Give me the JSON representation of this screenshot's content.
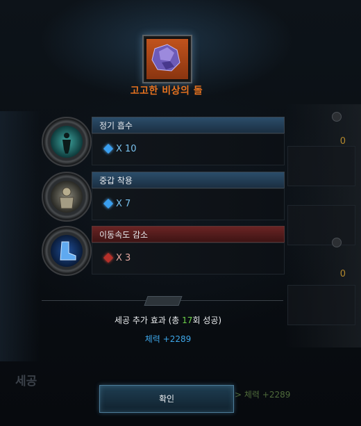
{
  "item": {
    "name": "고고한 비상의 돌",
    "icon": "amethyst-stone-icon"
  },
  "engravings": [
    {
      "name": "정기 흡수",
      "count": "X 10",
      "type": "positive",
      "icon": "dark-figure-icon",
      "color": "#2b4d6a"
    },
    {
      "name": "중갑 착용",
      "count": "X 7",
      "type": "positive",
      "icon": "armored-knight-icon",
      "color": "#2b4d6a"
    },
    {
      "name": "이동속도 감소",
      "count": "X 3",
      "type": "negative",
      "icon": "blue-boot-icon",
      "color": "#6a2424"
    }
  ],
  "effect": {
    "prefix": "세공 추가 효과 (총 ",
    "success_count": "17",
    "suffix": "회 성공)",
    "value": "체력 +2289"
  },
  "confirm_label": "확인",
  "background": {
    "right_numbers": [
      "0",
      "0"
    ],
    "bottom_left_text": "세공",
    "bottom_right_text": "> 체력 +2289"
  }
}
